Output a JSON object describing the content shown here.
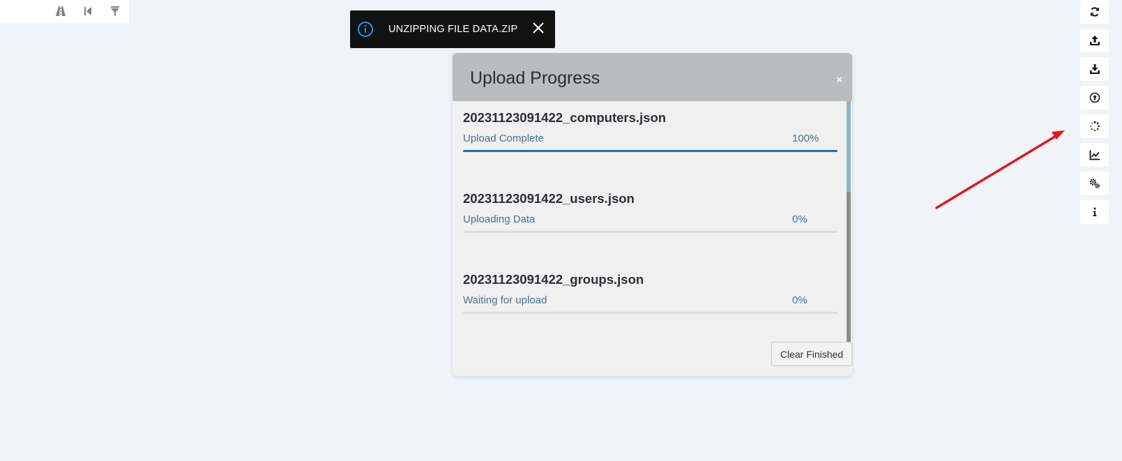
{
  "top_left_toolbar": {
    "icons": [
      "road-icon",
      "skip-back-icon",
      "filter-icon"
    ]
  },
  "toast": {
    "message": "UNZIPPING FILE DATA.ZIP",
    "icon": "info-icon",
    "accent": "#2196f3"
  },
  "modal": {
    "title": "Upload Progress",
    "close_label": "×",
    "clear_label": "Clear Finished",
    "items": [
      {
        "file": "20231123091422_computers.json",
        "status": "Upload Complete",
        "percent_label": "100%",
        "progress": 1.0
      },
      {
        "file": "20231123091422_users.json",
        "status": "Uploading Data",
        "percent_label": "0%",
        "progress": 0.0
      },
      {
        "file": "20231123091422_groups.json",
        "status": "Waiting for upload",
        "percent_label": "0%",
        "progress": 0.0
      }
    ]
  },
  "right_toolbar": {
    "icons": [
      "refresh-icon",
      "upload-icon",
      "download-icon",
      "circle-arrow-up-icon",
      "spinner-icon",
      "line-chart-icon",
      "settings-gears-icon",
      "info-letter-icon"
    ]
  },
  "colors": {
    "background": "#f0f3f8",
    "progress_fill": "#2d6da3",
    "annotation_arrow": "#e01818"
  }
}
